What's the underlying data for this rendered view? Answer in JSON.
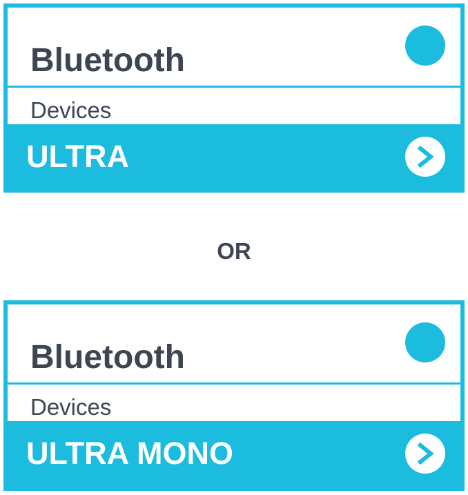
{
  "cards": [
    {
      "title": "Bluetooth",
      "devices_label": "Devices",
      "device_name": "ULTRA",
      "chevron_icon": "chevron-right-icon",
      "status_icon": "status-dot-icon"
    },
    {
      "title": "Bluetooth",
      "devices_label": "Devices",
      "device_name": "ULTRA MONO",
      "chevron_icon": "chevron-right-icon",
      "status_icon": "status-dot-icon"
    }
  ],
  "separator": "OR",
  "colors": {
    "accent": "#1bbcde",
    "text": "#3d4452",
    "background": "#ffffff"
  }
}
